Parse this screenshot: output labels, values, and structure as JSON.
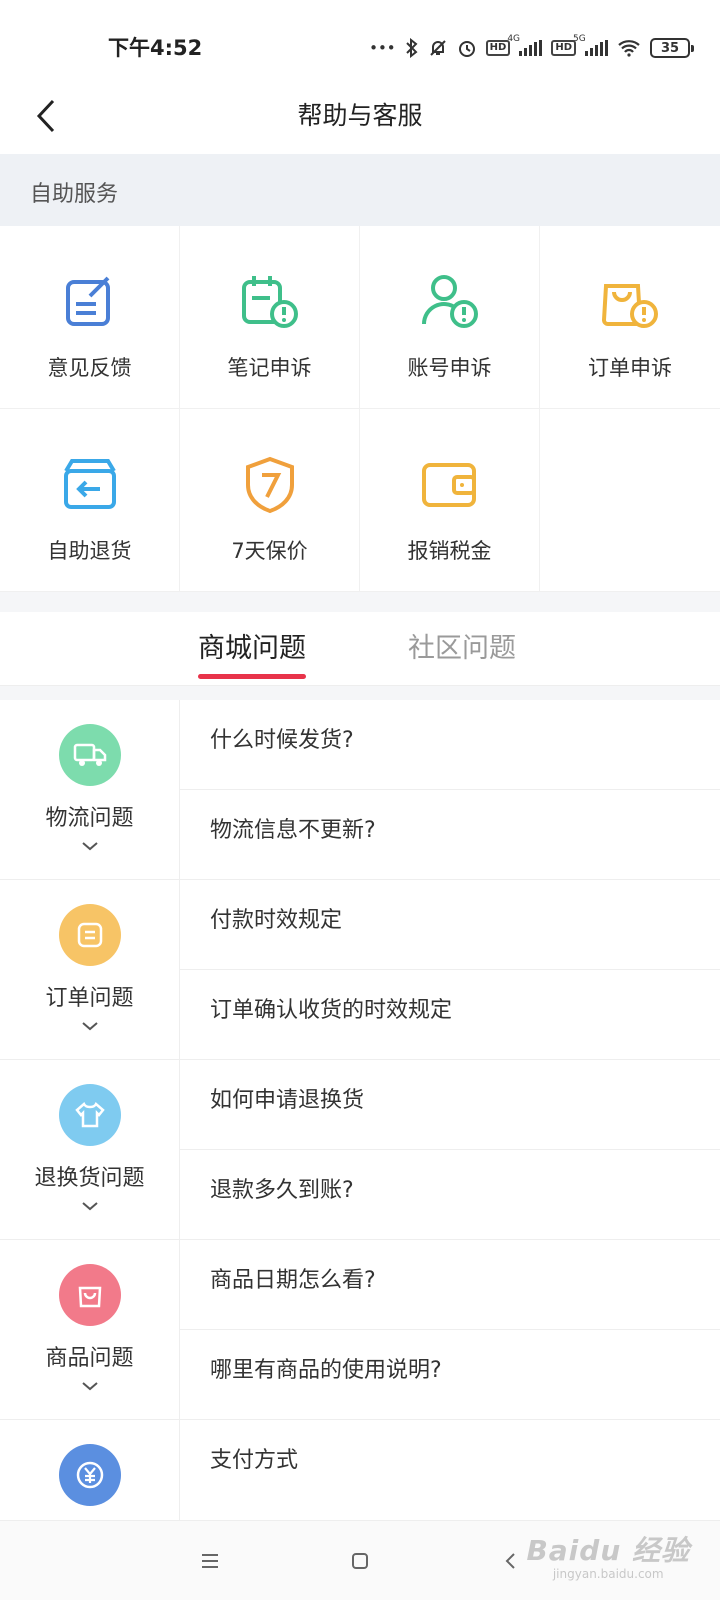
{
  "status_bar": {
    "time": "下午4:52",
    "signal_4g": "4G",
    "signal_5g": "5G",
    "hd": "HD",
    "battery": "35"
  },
  "header": {
    "title": "帮助与客服"
  },
  "self_service": {
    "title": "自助服务",
    "items": [
      {
        "label": "意见反馈",
        "icon": "feedback-icon",
        "color": "#4a7fd6"
      },
      {
        "label": "笔记申诉",
        "icon": "note-appeal-icon",
        "color": "#3fbf8a"
      },
      {
        "label": "账号申诉",
        "icon": "account-appeal-icon",
        "color": "#3fbf8a"
      },
      {
        "label": "订单申诉",
        "icon": "order-appeal-icon",
        "color": "#f0b43c"
      },
      {
        "label": "自助退货",
        "icon": "return-box-icon",
        "color": "#3aa8e8"
      },
      {
        "label": "7天保价",
        "icon": "price-protect-shield-icon",
        "color": "#f0a03c"
      },
      {
        "label": "报销税金",
        "icon": "wallet-icon",
        "color": "#f0b43c"
      }
    ]
  },
  "tabs": {
    "active": "商城问题",
    "inactive": "社区问题",
    "accent": "#e8334a"
  },
  "faq_groups": [
    {
      "category": "物流问题",
      "icon": "truck-icon",
      "color": "#7ddcad",
      "questions": [
        "什么时候发货?",
        "物流信息不更新?"
      ]
    },
    {
      "category": "订单问题",
      "icon": "order-doc-icon",
      "color": "#f7c466",
      "questions": [
        "付款时效规定",
        "订单确认收货的时效规定"
      ]
    },
    {
      "category": "退换货问题",
      "icon": "shirt-icon",
      "color": "#7fcbf0",
      "questions": [
        "如何申请退换货",
        "退款多久到账?"
      ]
    },
    {
      "category": "商品问题",
      "icon": "shopping-bag-icon",
      "color": "#f27a8a",
      "questions": [
        "商品日期怎么看?",
        "哪里有商品的使用说明?"
      ]
    },
    {
      "category": "",
      "icon": "yuan-coin-icon",
      "color": "#5b8fe0",
      "questions": [
        "支付方式"
      ]
    }
  ],
  "watermark": {
    "main": "Baidu 经验",
    "sub": "jingyan.baidu.com"
  }
}
